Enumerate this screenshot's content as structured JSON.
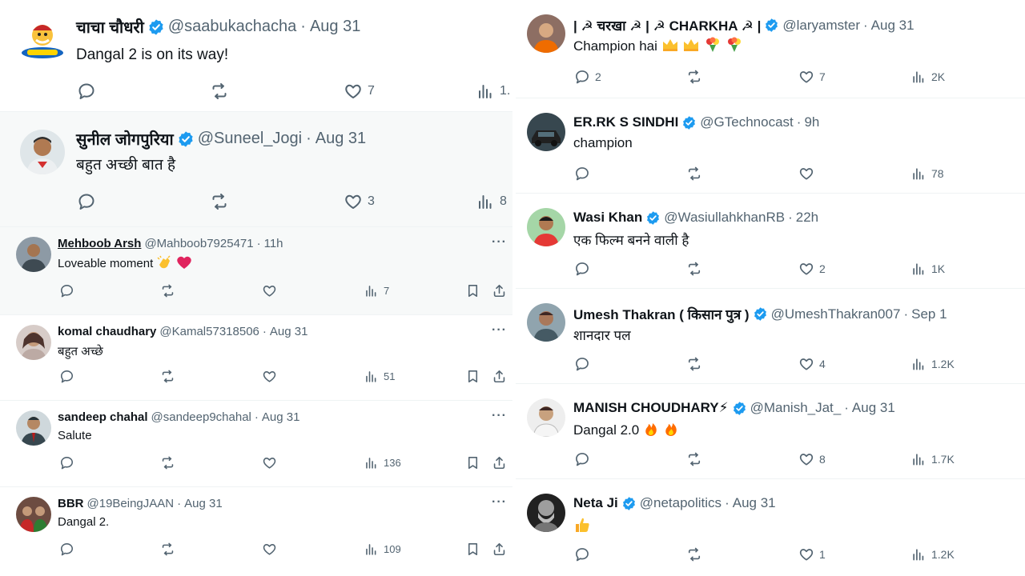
{
  "left": {
    "tweets_large": [
      {
        "name": "चाचा चौधरी",
        "verified": true,
        "handle": "@saabukachacha",
        "time": "Aug 31",
        "text": "Dangal 2 is on its way!",
        "reply_count": "",
        "retweet_count": "",
        "like_count": "7",
        "view_count": "1.",
        "avatar_icon": "chacha-chaudhary-logo"
      },
      {
        "name": "सुनील जोगपुरिया",
        "verified": true,
        "handle": "@Suneel_Jogi",
        "time": "Aug 31",
        "text": "बहुत अच्छी बात है",
        "reply_count": "",
        "retweet_count": "",
        "like_count": "3",
        "view_count": "8",
        "avatar_icon": "man-photo"
      }
    ],
    "tweets_small": [
      {
        "name": "Mehboob Arsh",
        "verified": false,
        "handle": "@Mahboob7925471",
        "time": "11h",
        "text": "Loveable moment",
        "emojis": [
          "clapping-hands",
          "red-heart"
        ],
        "view_count": "7"
      },
      {
        "name": "komal chaudhary",
        "verified": false,
        "handle": "@Kamal57318506",
        "time": "Aug 31",
        "text": "बहुत अच्छे",
        "emojis": [],
        "view_count": "51"
      },
      {
        "name": "sandeep chahal",
        "verified": false,
        "handle": "@sandeep9chahal",
        "time": "Aug 31",
        "text": "Salute",
        "emojis": [],
        "view_count": "136"
      },
      {
        "name": "BBR",
        "verified": false,
        "handle": "@19BeingJAAN",
        "time": "Aug 31",
        "text": "Dangal 2.",
        "emojis": [],
        "view_count": "109"
      }
    ]
  },
  "right": {
    "tweets": [
      {
        "name": "| ☭ चरखा ☭ | ☭ CHARKHA ☭ |",
        "verified": true,
        "handle": "@laryamster",
        "time": "Aug 31",
        "text": "Champion hai",
        "emojis": [
          "crown",
          "crown",
          "bouquet",
          "bouquet"
        ],
        "reply_count": "2",
        "like_count": "7",
        "view_count": "2K"
      },
      {
        "name": "ER.RK S SINDHI",
        "verified": true,
        "handle": "@GTechnocast",
        "time": "9h",
        "text": "champion",
        "emojis": [],
        "reply_count": "",
        "like_count": "",
        "view_count": "78"
      },
      {
        "name": "Wasi Khan",
        "verified": true,
        "handle": "@WasiullahkhanRB",
        "time": "22h",
        "text": "एक फिल्म बनने वाली है",
        "emojis": [],
        "reply_count": "",
        "like_count": "2",
        "view_count": "1K"
      },
      {
        "name": "Umesh Thakran ( किसान पुत्र )",
        "verified": true,
        "handle": "@UmeshThakran007",
        "time": "Sep 1",
        "text": "शानदार पल",
        "emojis": [],
        "reply_count": "",
        "like_count": "4",
        "view_count": "1.2K"
      },
      {
        "name": "MANISH CHOUDHARY⚡",
        "verified": true,
        "handle": "@Manish_Jat_",
        "time": "Aug 31",
        "text": "Dangal 2.0",
        "emojis": [
          "fire",
          "fire"
        ],
        "reply_count": "",
        "like_count": "8",
        "view_count": "1.7K"
      },
      {
        "name": "Neta Ji",
        "verified": true,
        "handle": "@netapolitics",
        "time": "Aug 31",
        "text": "",
        "emojis": [
          "thumbs-up"
        ],
        "reply_count": "",
        "like_count": "1",
        "view_count": "1.2K"
      }
    ]
  },
  "separator": "·",
  "more_label": "···",
  "colors": {
    "verified": "#1d9bf0",
    "secondary_text": "#536471",
    "primary_text": "#0f1419",
    "gray_bg": "#f7f9f9",
    "border": "#eff3f4"
  }
}
